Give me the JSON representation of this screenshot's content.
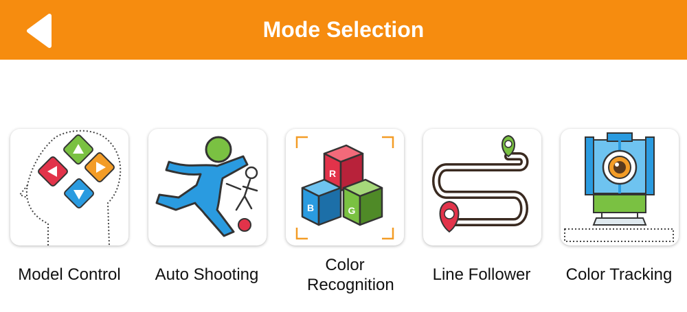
{
  "header": {
    "title": "Mode Selection",
    "back_icon": "back-arrow-icon",
    "background_color": "#f68c0f"
  },
  "modes": [
    {
      "label": "Model Control",
      "icon": "gamepad-head-icon"
    },
    {
      "label": "Auto Shooting",
      "icon": "soccer-player-icon"
    },
    {
      "label": "Color Recognition",
      "icon": "rgb-cubes-icon"
    },
    {
      "label": "Line Follower",
      "icon": "route-path-icon"
    },
    {
      "label": "Color Tracking",
      "icon": "camera-robot-icon"
    }
  ]
}
